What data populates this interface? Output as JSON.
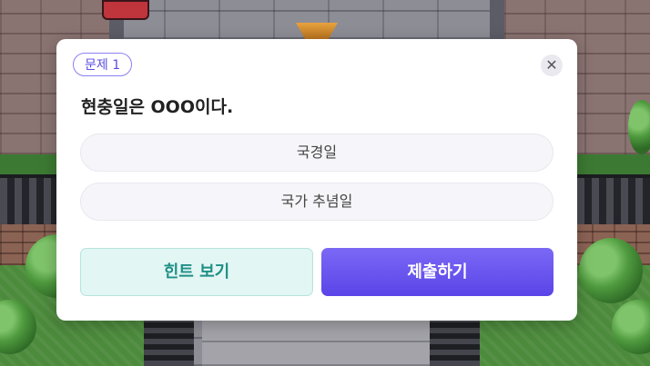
{
  "quiz": {
    "badge": "문제 1",
    "close_icon": "close-icon",
    "question": "현충일은 OOO이다.",
    "options": [
      {
        "label": "국경일"
      },
      {
        "label": "국가 추념일"
      }
    ],
    "hint_label": "힌트 보기",
    "submit_label": "제출하기"
  },
  "colors": {
    "accent": "#5a44e8",
    "hint_bg": "#e2f6f4",
    "hint_text": "#1f8f86",
    "badge_border": "#8b80f0"
  }
}
